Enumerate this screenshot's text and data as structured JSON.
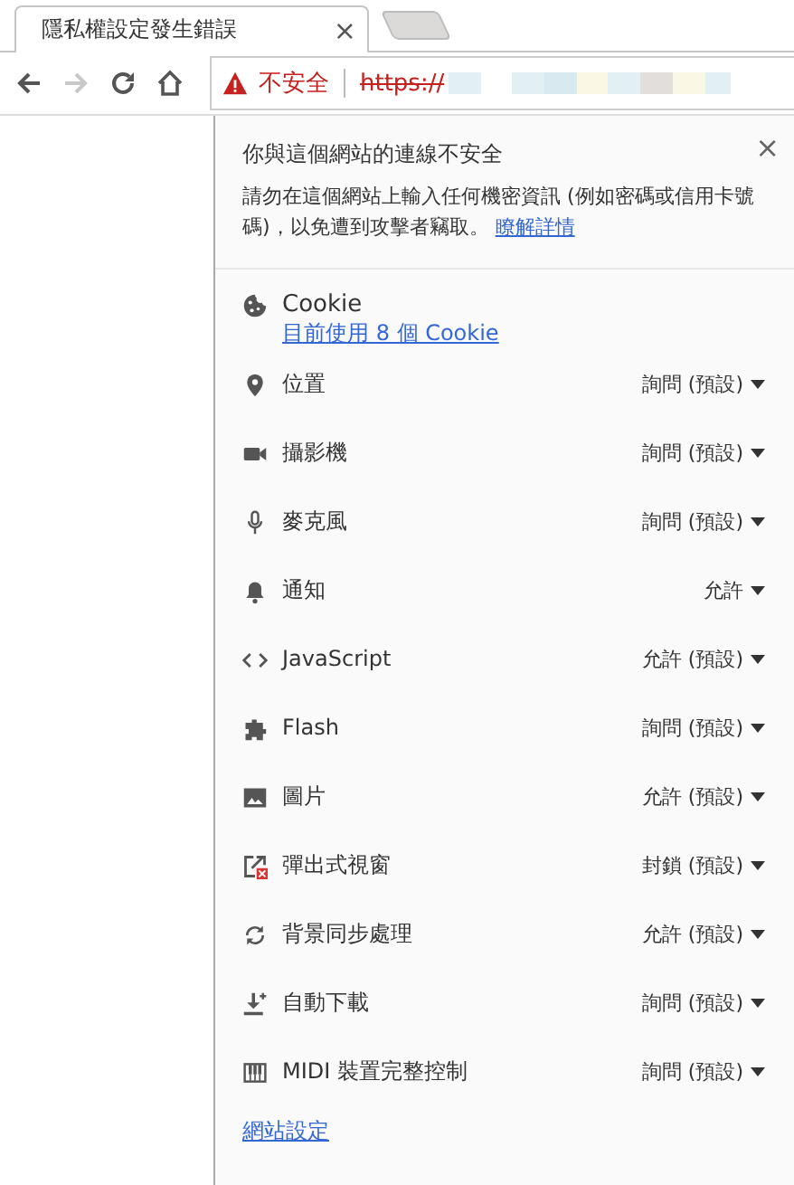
{
  "tab": {
    "title": "隱私權設定發生錯誤",
    "close": "×"
  },
  "toolbar": {
    "back_disabled": false,
    "forward_disabled": true
  },
  "omnibox": {
    "security_label": "不安全",
    "scheme": "https://"
  },
  "popup": {
    "close": "×",
    "title": "你與這個網站的連線不安全",
    "message": "請勿在這個網站上輸入任何機密資訊 (例如密碼或信用卡號碼)，以免遭到攻擊者竊取。",
    "learn_more": "瞭解詳情",
    "cookie": {
      "label": "Cookie",
      "link": "目前使用 8 個 Cookie"
    },
    "permissions": [
      {
        "kind": "location",
        "label": "位置",
        "value": "詢問 (預設)"
      },
      {
        "kind": "camera",
        "label": "攝影機",
        "value": "詢問 (預設)"
      },
      {
        "kind": "microphone",
        "label": "麥克風",
        "value": "詢問 (預設)"
      },
      {
        "kind": "notifications",
        "label": "通知",
        "value": "允許"
      },
      {
        "kind": "javascript",
        "label": "JavaScript",
        "value": "允許 (預設)"
      },
      {
        "kind": "flash",
        "label": "Flash",
        "value": "詢問 (預設)"
      },
      {
        "kind": "images",
        "label": "圖片",
        "value": "允許 (預設)"
      },
      {
        "kind": "popups",
        "label": "彈出式視窗",
        "value": "封鎖 (預設)"
      },
      {
        "kind": "sync",
        "label": "背景同步處理",
        "value": "允許 (預設)"
      },
      {
        "kind": "download",
        "label": "自動下載",
        "value": "詢問 (預設)"
      },
      {
        "kind": "midi",
        "label": "MIDI 裝置完整控制",
        "value": "詢問 (預設)"
      }
    ],
    "site_settings": "網站設定"
  }
}
